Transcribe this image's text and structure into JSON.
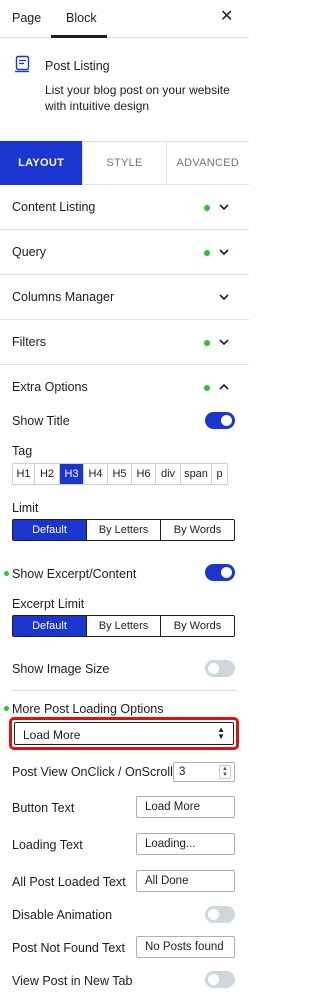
{
  "header": {
    "tab_page": "Page",
    "tab_block": "Block",
    "close_glyph": "✕"
  },
  "block": {
    "title": "Post Listing",
    "description": "List your blog post on your website with intuitive design",
    "icon": "post-listing-icon"
  },
  "mode_tabs": {
    "layout": "LAYOUT",
    "style": "STYLE",
    "advanced": "ADVANCED",
    "active": "LAYOUT"
  },
  "panels": {
    "content_listing": "Content Listing",
    "query": "Query",
    "columns_manager": "Columns Manager",
    "filters": "Filters",
    "extra_options": "Extra Options"
  },
  "extra_options": {
    "show_title": {
      "label": "Show Title",
      "enabled": true
    },
    "tag": {
      "label": "Tag",
      "options": [
        "H1",
        "H2",
        "H3",
        "H4",
        "H5",
        "H6",
        "div",
        "span",
        "p"
      ],
      "selected": "H3"
    },
    "limit": {
      "label": "Limit",
      "options": [
        "Default",
        "By Letters",
        "By Words"
      ],
      "selected": "Default"
    },
    "show_excerpt": {
      "label": "Show Excerpt/Content",
      "enabled": true
    },
    "excerpt_limit": {
      "label": "Excerpt Limit",
      "options": [
        "Default",
        "By Letters",
        "By Words"
      ],
      "selected": "Default"
    },
    "show_image_size": {
      "label": "Show Image Size",
      "enabled": false
    },
    "more_post_loading": {
      "label": "More Post Loading Options",
      "selected": "Load More"
    },
    "post_view": {
      "label": "Post View OnClick / OnScroll",
      "value": "3"
    },
    "button_text": {
      "label": "Button Text",
      "value": "Load More"
    },
    "loading_text": {
      "label": "Loading Text",
      "value": "Loading..."
    },
    "all_loaded_text": {
      "label": "All Post Loaded Text",
      "value": "All Done"
    },
    "disable_animation": {
      "label": "Disable Animation",
      "enabled": false
    },
    "not_found_text": {
      "label": "Post Not Found Text",
      "value": "No Posts found"
    },
    "new_tab": {
      "label": "View Post in New Tab",
      "enabled": false
    }
  },
  "colors": {
    "accent": "#1b35d1",
    "status_dot": "#2ec32e",
    "highlight_border": "#e01010"
  }
}
